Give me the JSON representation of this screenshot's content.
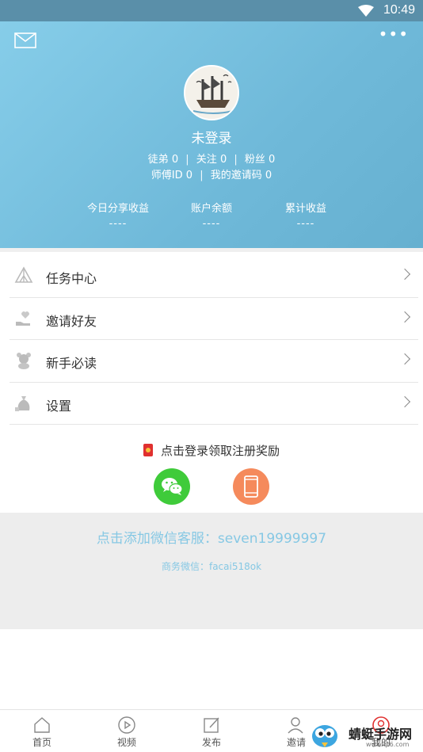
{
  "status_bar": {
    "time": "10:49"
  },
  "header": {
    "username": "未登录",
    "stats_line1": [
      {
        "label": "徒弟",
        "value": "0"
      },
      {
        "label": "关注",
        "value": "0"
      },
      {
        "label": "粉丝",
        "value": "0"
      }
    ],
    "stats_line2": [
      {
        "label": "师傅ID",
        "value": "0"
      },
      {
        "label": "我的邀请码",
        "value": "0"
      }
    ],
    "earnings": [
      {
        "label": "今日分享收益",
        "value": "----"
      },
      {
        "label": "账户余额",
        "value": "----"
      },
      {
        "label": "累计收益",
        "value": "----"
      }
    ]
  },
  "menu": [
    {
      "label": "任务中心",
      "icon": "tent-icon"
    },
    {
      "label": "邀请好友",
      "icon": "heart-hand-icon"
    },
    {
      "label": "新手必读",
      "icon": "bear-icon"
    },
    {
      "label": "设置",
      "icon": "money-bag-icon"
    }
  ],
  "login_prompt": "点击登录领取注册奖励",
  "service": {
    "main": "点击添加微信客服：seven19999997",
    "sub": "商务微信：facai518ok"
  },
  "tabbar": [
    {
      "label": "首页",
      "icon": "home-icon"
    },
    {
      "label": "视频",
      "icon": "play-icon"
    },
    {
      "label": "发布",
      "icon": "edit-icon"
    },
    {
      "label": "邀请",
      "icon": "person-add-icon"
    },
    {
      "label": "我的",
      "icon": "profile-icon"
    }
  ],
  "watermark": {
    "name": "蜻蜓手游网",
    "url": "www.qt6.com"
  },
  "colors": {
    "header": "#78c2e0",
    "service_text": "#86c8e4",
    "wechat": "#3fcb3a",
    "phone": "#f58a5c"
  }
}
